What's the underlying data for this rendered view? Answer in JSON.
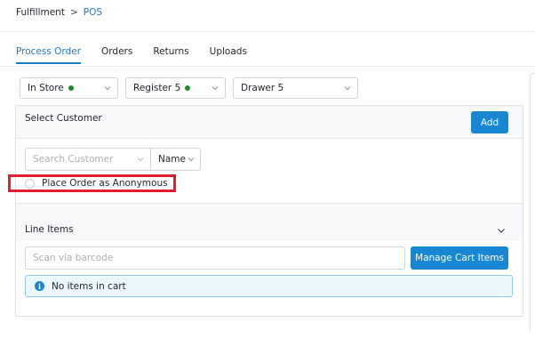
{
  "breadcrumb": {
    "parent": "Fulfillment",
    "separator": ">",
    "current": "POS"
  },
  "tabs": [
    {
      "label": "Process Order",
      "active": true
    },
    {
      "label": "Orders",
      "active": false
    },
    {
      "label": "Returns",
      "active": false
    },
    {
      "label": "Uploads",
      "active": false
    }
  ],
  "selectors": {
    "location": {
      "value": "In Store",
      "status": "online"
    },
    "register": {
      "value": "Register 5",
      "status": "online"
    },
    "drawer": {
      "value": "Drawer 5"
    }
  },
  "customer": {
    "title": "Select Customer",
    "add_label": "Add",
    "search_placeholder": "Search Customer",
    "search_by": "Name",
    "anonymous_label": "Place Order as Anonymous"
  },
  "line_items": {
    "title": "Line Items",
    "barcode_placeholder": "Scan via barcode",
    "manage_label": "Manage Cart Items",
    "empty_message": "No items in cart"
  },
  "colors": {
    "accent": "#1787d4",
    "status_online": "#1e8a2f",
    "highlight": "#e01e2e"
  }
}
